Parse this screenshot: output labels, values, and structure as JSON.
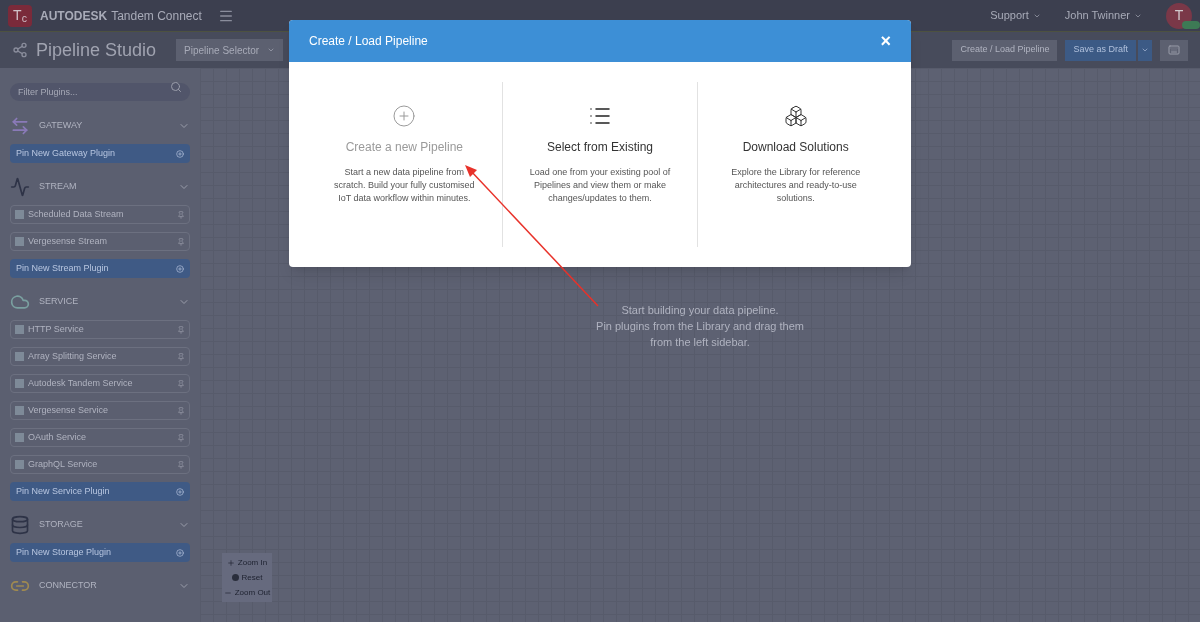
{
  "topbar": {
    "logo": "T$_{c}$",
    "brand": "AUTODESK",
    "product": "Tandem Connect",
    "menus": [
      "Support",
      "John Twinner"
    ],
    "avatar": "T"
  },
  "toolbar": {
    "title": "Pipeline Studio",
    "selector": "Pipeline Selector",
    "buttons": [
      {
        "kind": "secondary",
        "label": "Create / Load Pipeline"
      },
      {
        "kind": "primary",
        "label": "Save as Draft"
      }
    ]
  },
  "sidebar": {
    "filter": {
      "placeholder": "Filter Plugins..."
    },
    "sections": [
      {
        "kind": "gateway",
        "title": "GATEWAY",
        "pin": "Pin New Gateway Plugin"
      },
      {
        "kind": "stream",
        "title": "STREAM",
        "items": [
          "Scheduled Data Stream",
          "Vergesense Stream"
        ],
        "pin": "Pin New Stream Plugin"
      },
      {
        "kind": "service",
        "title": "SERVICE",
        "items": [
          "HTTP Service",
          "Array Splitting Service",
          "Autodesk Tandem Service",
          "Vergesense Service",
          "OAuth Service",
          "GraphQL Service"
        ],
        "pin": "Pin New Service Plugin"
      },
      {
        "kind": "storage",
        "title": "STORAGE",
        "pin": "Pin New Storage Plugin"
      },
      {
        "kind": "connector",
        "title": "CONNECTOR"
      }
    ]
  },
  "canvas": {
    "message": [
      "Start building your data pipeline.",
      "Pin plugins from the Library and drag them",
      "from the left sidebar."
    ],
    "zoom_controls": [
      {
        "kind": "in",
        "label": "Zoom In"
      },
      {
        "kind": "reset",
        "label": "Reset"
      },
      {
        "kind": "out",
        "label": "Zoom Out"
      }
    ]
  },
  "dialog": {
    "title": "Create / Load Pipeline",
    "close": "×",
    "options": [
      {
        "kind": "create",
        "title": "Create a new Pipeline",
        "selected": false,
        "description": "Start a new data pipeline from scratch. Build your fully customised IoT data workflow within minutes."
      },
      {
        "kind": "select",
        "title": "Select from Existing",
        "selected": true,
        "description": "Load one from your existing pool of Pipelines and view them or make changes/updates to them."
      },
      {
        "kind": "download",
        "title": "Download Solutions",
        "selected": true,
        "description": "Explore the Library for reference architectures and ready-to-use solutions."
      }
    ]
  }
}
